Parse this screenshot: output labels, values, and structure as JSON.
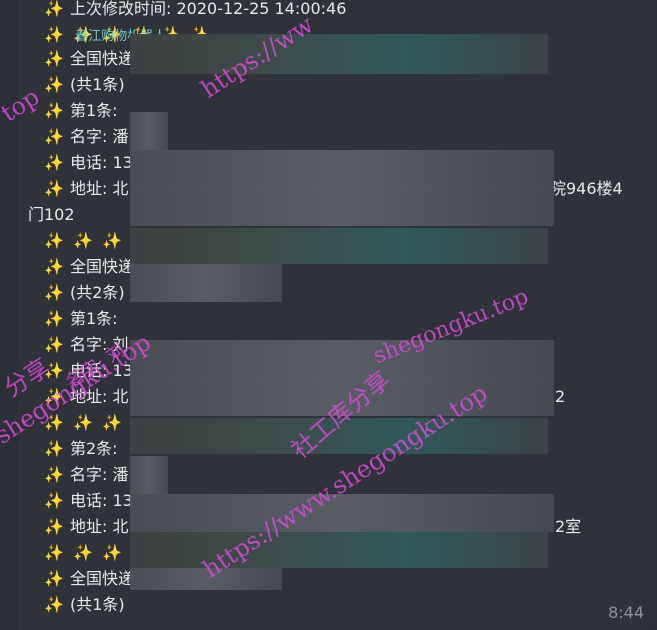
{
  "message": {
    "lines": [
      {
        "text": "上次修改时间: 2020-12-25 14:00:46"
      },
      {
        "text": "✨ ✨ ✨ ✨ ✨ ✨",
        "accent": "春江购物机器人"
      },
      {
        "text": "全国快递"
      },
      {
        "text": "(共1条)"
      },
      {
        "text": "第1条:"
      },
      {
        "text": "名字: 潘"
      },
      {
        "text": "电话: 13"
      },
      {
        "text": "地址: 北",
        "tail": "院946楼4"
      },
      {
        "text": "门102"
      },
      {
        "text": "✨ ✨ ✨"
      },
      {
        "text": "全国快递"
      },
      {
        "text": "(共2条)"
      },
      {
        "text": "第1条:"
      },
      {
        "text": "名字: 刘"
      },
      {
        "text": "电话: 13"
      },
      {
        "text": "地址: 北",
        "tail": "2"
      },
      {
        "text": "✨ ✨ ✨"
      },
      {
        "text": "第2条:"
      },
      {
        "text": "名字: 潘"
      },
      {
        "text": "电话: 13"
      },
      {
        "text": "地址: 北",
        "tail": "2室"
      },
      {
        "text": "✨ ✨ ✨"
      },
      {
        "text": "全国快递"
      },
      {
        "text": "(共1条)"
      }
    ],
    "time": "8:44"
  },
  "watermarks": {
    "url1": "https://ww",
    "url2": "https://www.shegongku.top",
    "url3": "shegongku.top",
    "brand": "社工库分享",
    "left1": "top",
    "left2": "分享",
    "left3": "shegongku.top",
    "left4": "名字: 刘"
  },
  "colors": {
    "accent": "#6ec9c6",
    "sparkle": "#f7c948",
    "watermark": "#d74bd8",
    "text": "#e7e9ec"
  }
}
